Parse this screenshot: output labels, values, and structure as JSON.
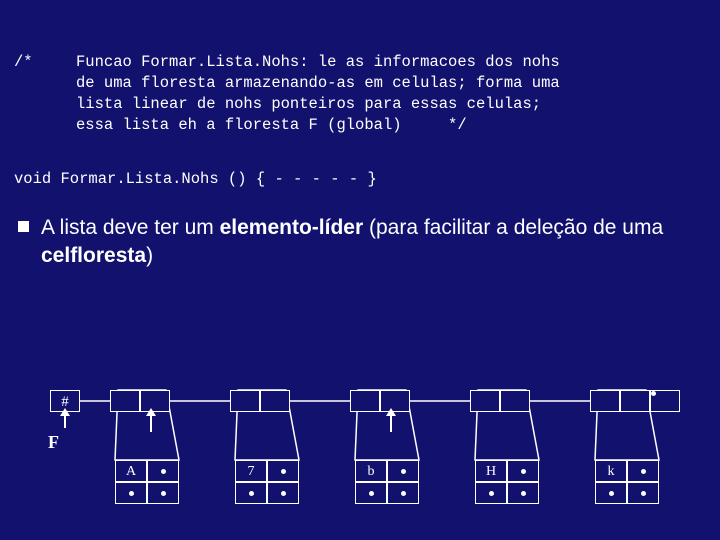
{
  "comment": {
    "marker": "/*",
    "line1": "Funcao Formar.Lista.Nohs: le as informacoes dos nohs",
    "line2": "de uma floresta armazenando-as em celulas; forma uma",
    "line3": "lista linear de nohs ponteiros para essas celulas;",
    "line4": "essa lista eh a floresta F (global)     */"
  },
  "func_decl": "void Formar.Lista.Nohs () { - - - - - }",
  "bullet": {
    "pre": "A lista deve ter um ",
    "bold1": "elemento-líder",
    "mid": " (para facilitar a deleção de uma ",
    "bold2": "celfloresta",
    "post": ")"
  },
  "list": {
    "leader": "#",
    "tail_dot": "•"
  },
  "f_label": "F",
  "cells": [
    {
      "value": "A"
    },
    {
      "value": "7"
    },
    {
      "value": "b"
    },
    {
      "value": "H"
    },
    {
      "value": "k"
    }
  ]
}
